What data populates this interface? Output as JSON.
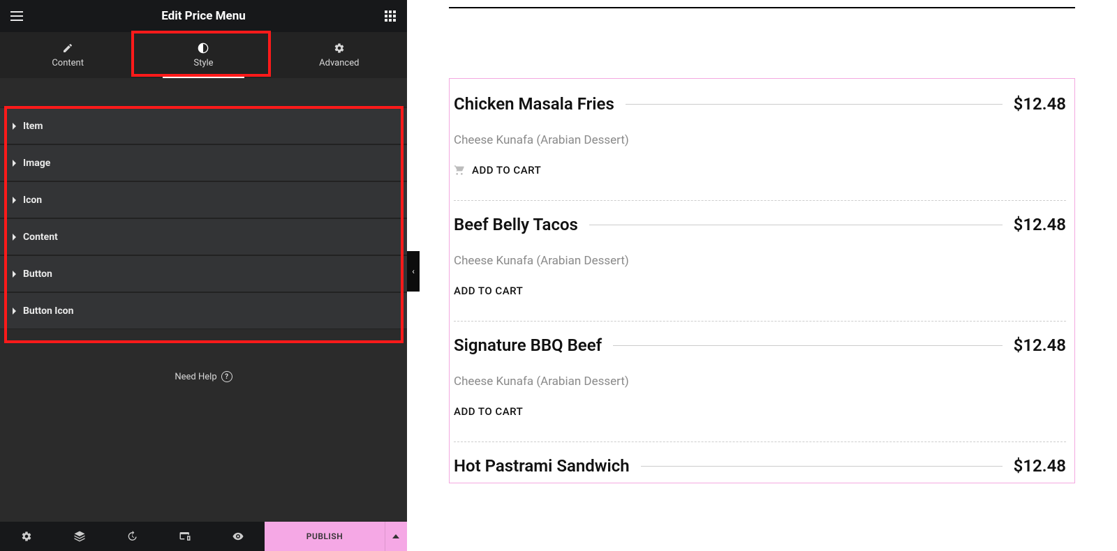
{
  "header": {
    "title": "Edit Price Menu"
  },
  "tabs": {
    "content": "Content",
    "style": "Style",
    "advanced": "Advanced",
    "active": "style"
  },
  "accordions": [
    "Item",
    "Image",
    "Icon",
    "Content",
    "Button",
    "Button Icon"
  ],
  "help": {
    "label": "Need Help"
  },
  "footer": {
    "publish_label": "PUBLISH"
  },
  "menu": {
    "items": [
      {
        "name": "Chicken Masala Fries",
        "price": "$12.48",
        "desc": "Cheese Kunafa (Arabian Dessert)",
        "cart": "ADD TO CART",
        "show_icon": true
      },
      {
        "name": "Beef Belly Tacos",
        "price": "$12.48",
        "desc": "Cheese Kunafa (Arabian Dessert)",
        "cart": "ADD TO CART",
        "show_icon": false
      },
      {
        "name": "Signature BBQ Beef",
        "price": "$12.48",
        "desc": "Cheese Kunafa (Arabian Dessert)",
        "cart": "ADD TO CART",
        "show_icon": false
      },
      {
        "name": "Hot Pastrami Sandwich",
        "price": "$12.48",
        "desc": "",
        "cart": "",
        "show_icon": false
      }
    ]
  }
}
